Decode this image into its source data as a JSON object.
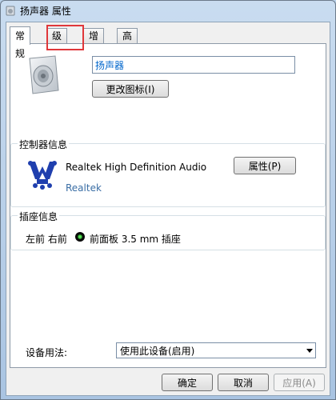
{
  "window": {
    "title": "扬声器 属性"
  },
  "tabs": [
    {
      "label": "常规",
      "active": true
    },
    {
      "label": "级别",
      "active": false
    },
    {
      "label": "增强",
      "active": false
    },
    {
      "label": "高级",
      "active": false
    }
  ],
  "device": {
    "icon": "speaker-icon",
    "name_value": "扬声器",
    "change_icon_label": "更改图标(I)"
  },
  "controller": {
    "group_label": "控制器信息",
    "icon": "realtek-icon",
    "name": "Realtek High Definition Audio",
    "vendor_link": "Realtek",
    "properties_label": "属性(P)"
  },
  "jack": {
    "group_label": "插座信息",
    "channels": "左前 右前",
    "jack_color": "#2bb52b",
    "description": "前面板 3.5 mm 插座"
  },
  "usage": {
    "label": "设备用法:",
    "selected": "使用此设备(启用)"
  },
  "buttons": {
    "ok": "确定",
    "cancel": "取消",
    "apply": "应用(A)"
  },
  "colors": {
    "highlight": "#e0373a",
    "link": "#3a6ea5"
  }
}
